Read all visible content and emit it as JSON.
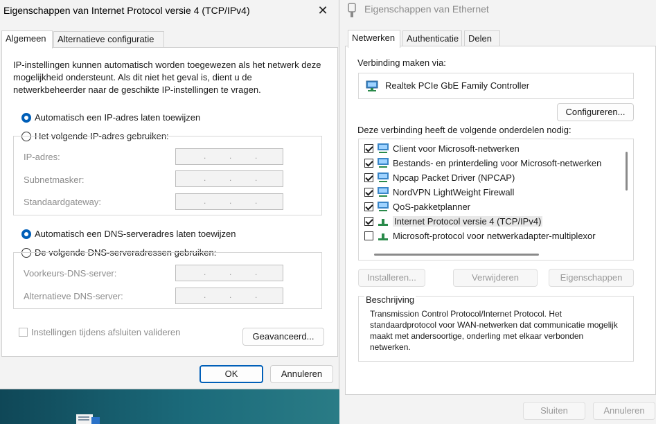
{
  "left_dialog": {
    "title": "Eigenschappen van Internet Protocol versie 4 (TCP/IPv4)",
    "tabs": [
      "Algemeen",
      "Alternatieve configuratie"
    ],
    "description": "IP-instellingen kunnen automatisch worden toegewezen als het netwerk deze mogelijkheid ondersteunt. Als dit niet het geval is, dient u de netwerkbeheerder naar de geschikte IP-instellingen te vragen.",
    "ip_auto_label": "Automatisch een IP-adres laten toewijzen",
    "ip_manual_label": "Het volgende IP-adres gebruiken:",
    "ip_fields": [
      "IP-adres:",
      "Subnetmasker:",
      "Standaardgateway:"
    ],
    "dns_auto_label": "Automatisch een DNS-serveradres laten toewijzen",
    "dns_manual_label": "De volgende DNS-serveradressen gebruiken:",
    "dns_fields": [
      "Voorkeurs-DNS-server:",
      "Alternatieve DNS-server:"
    ],
    "validate_label": "Instellingen tijdens afsluiten valideren",
    "advanced_label": "Geavanceerd...",
    "ok_label": "OK",
    "cancel_label": "Annuleren"
  },
  "right_dialog": {
    "title": "Eigenschappen van Ethernet",
    "tabs": [
      "Netwerken",
      "Authenticatie",
      "Delen"
    ],
    "connect_via_label": "Verbinding maken via:",
    "adapter_name": "Realtek PCIe GbE Family Controller",
    "configure_label": "Configureren...",
    "components_label": "Deze verbinding heeft de volgende onderdelen nodig:",
    "components": [
      {
        "label": "Client voor Microsoft-netwerken",
        "checked": true
      },
      {
        "label": "Bestands- en printerdeling voor Microsoft-netwerken",
        "checked": true
      },
      {
        "label": "Npcap Packet Driver (NPCAP)",
        "checked": true
      },
      {
        "label": "NordVPN LightWeight Firewall",
        "checked": true
      },
      {
        "label": "QoS-pakketplanner",
        "checked": true
      },
      {
        "label": "Internet Protocol versie 4 (TCP/IPv4)",
        "checked": true
      },
      {
        "label": "Microsoft-protocol voor netwerkadapter-multiplexor",
        "checked": false
      }
    ],
    "install_label": "Installeren...",
    "remove_label": "Verwijderen",
    "properties_label": "Eigenschappen",
    "description_title": "Beschrijving",
    "description_text": "Transmission Control Protocol/Internet Protocol. Het standaardprotocol voor WAN-netwerken dat communicatie mogelijk maakt met andersoortige, onderling met elkaar verbonden netwerken.",
    "close_label": "Sluiten",
    "cancel_label": "Annuleren"
  },
  "colors": {
    "accent": "#005fb8",
    "window_bg": "#f3f3f3"
  }
}
